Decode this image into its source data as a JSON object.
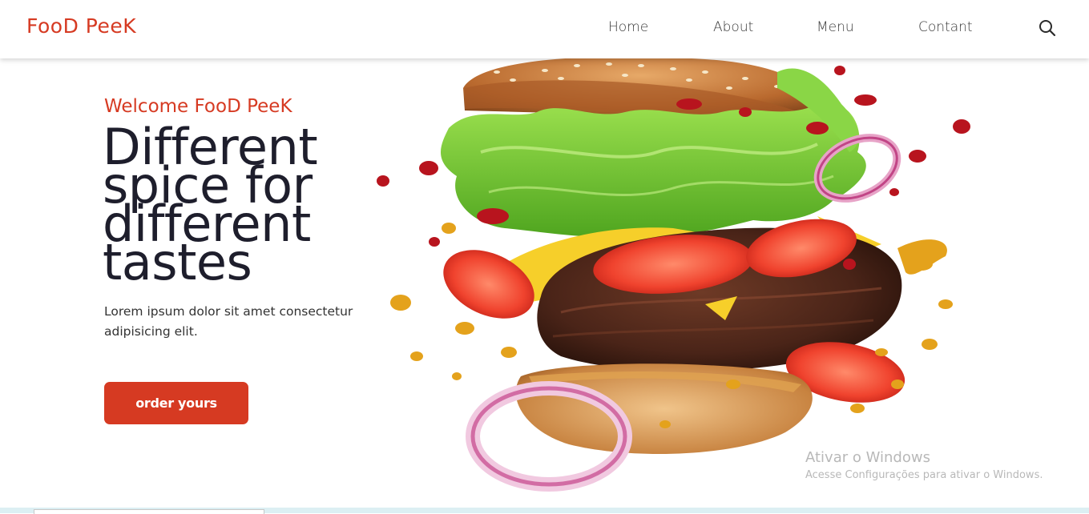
{
  "header": {
    "logo": "FooD PeeK",
    "nav": [
      "Home",
      "About",
      "Menu",
      "Contant"
    ],
    "search_icon": "search-icon"
  },
  "hero": {
    "welcome": "Welcome FooD PeeK",
    "headline": [
      "Different",
      "spice for",
      "different",
      "tastes"
    ],
    "subtext": "Lorem ipsum dolor sit amet consectetur adipisicing elit.",
    "button_label": "order yours"
  },
  "watermark": {
    "title": "Ativar o Windows",
    "subtitle": "Acesse Configurações para ativar o Windows."
  },
  "colors": {
    "accent": "#d63a22",
    "headline": "#1e1e2c",
    "background": "#ffffff"
  }
}
